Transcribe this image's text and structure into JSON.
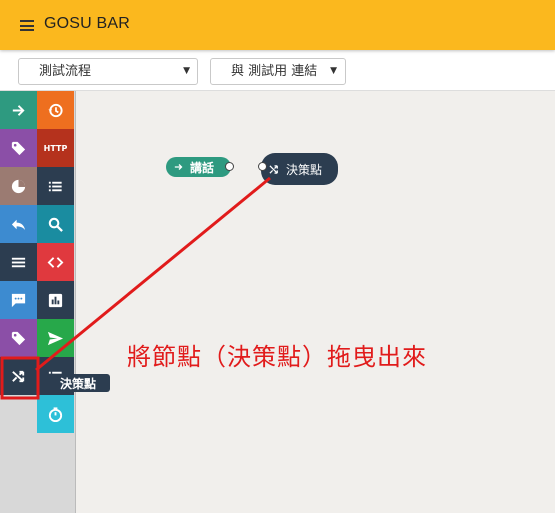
{
  "app": {
    "title": "GOSU BAR"
  },
  "toolbar": {
    "flow_select": {
      "value": "測試流程"
    },
    "link_select": {
      "value": "與 測試用 連結"
    }
  },
  "palette": {
    "tiles": [
      {
        "name": "arrow-right-icon",
        "color": "#2e9a80"
      },
      {
        "name": "history-icon",
        "color": "#ee6f1f"
      },
      {
        "name": "tag-icon",
        "color": "#8b4fa7"
      },
      {
        "name": "http-icon",
        "label": "HTTP",
        "color": "#b5321d"
      },
      {
        "name": "pie-chart-icon",
        "color": "#9b7b72"
      },
      {
        "name": "list-icon",
        "color": "#2c3d50"
      },
      {
        "name": "reply-icon",
        "color": "#3d8bd0"
      },
      {
        "name": "search-icon",
        "color": "#1a8ca0"
      },
      {
        "name": "menu-lines-icon",
        "color": "#2c3d50"
      },
      {
        "name": "code-icon",
        "color": "#e0393e"
      },
      {
        "name": "chat-icon",
        "color": "#3d8bd0"
      },
      {
        "name": "bar-chart-icon",
        "color": "#2c3d50"
      },
      {
        "name": "tag-icon",
        "color": "#8b4fa7"
      },
      {
        "name": "send-icon",
        "color": "#27a84a"
      },
      {
        "name": "shuffle-icon",
        "color": "#2c3d50"
      },
      {
        "name": "list-icon",
        "color": "#2c3d50"
      },
      {
        "name": "timer-icon",
        "color": "#2dc0d8"
      }
    ],
    "tooltip": "決策點"
  },
  "canvas": {
    "nodes": [
      {
        "id": "talk",
        "label": "講話",
        "icon": "arrow-right-icon",
        "color": "#2e9a80"
      },
      {
        "id": "decision",
        "label": "決策點",
        "icon": "shuffle-icon",
        "color": "#2c3d50"
      }
    ],
    "annotation": "將節點（決策點）拖曳出來",
    "annotation_color": "#e11b1b"
  }
}
